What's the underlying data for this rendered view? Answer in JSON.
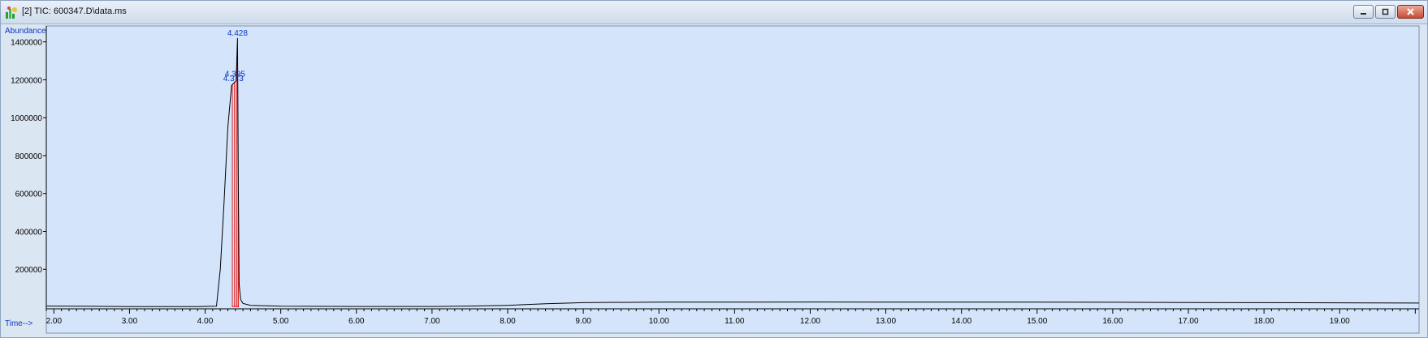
{
  "window": {
    "title": "[2] TIC: 600347.D\\data.ms",
    "icon": "chromatogram-app-icon",
    "controls": {
      "minimize": "minimize-icon",
      "restore": "restore-icon",
      "close": "close-icon"
    },
    "colors": {
      "plot_bg": "#d4e5fb",
      "frame": "#dbe6f3",
      "label": "#0b36c8",
      "trace": "#000000",
      "integration": "#e02020"
    }
  },
  "chart_data": {
    "type": "line",
    "xlabel": "Time-->",
    "ylabel": "Abundance",
    "xlim": [
      1.9,
      20.05
    ],
    "ylim": [
      0,
      1450000
    ],
    "x_ticks": [
      {
        "value": 2,
        "label": "2.00"
      },
      {
        "value": 3,
        "label": "3.00"
      },
      {
        "value": 4,
        "label": "4.00"
      },
      {
        "value": 5,
        "label": "5.00"
      },
      {
        "value": 6,
        "label": "6.00"
      },
      {
        "value": 7,
        "label": "7.00"
      },
      {
        "value": 8,
        "label": "8.00"
      },
      {
        "value": 9,
        "label": "9.00"
      },
      {
        "value": 10,
        "label": "10.00"
      },
      {
        "value": 11,
        "label": "11.00"
      },
      {
        "value": 12,
        "label": "12.00"
      },
      {
        "value": 13,
        "label": "13.00"
      },
      {
        "value": 14,
        "label": "14.00"
      },
      {
        "value": 15,
        "label": "15.00"
      },
      {
        "value": 16,
        "label": "16.00"
      },
      {
        "value": 17,
        "label": "17.00"
      },
      {
        "value": 18,
        "label": "18.00"
      },
      {
        "value": 19,
        "label": "19.00"
      }
    ],
    "y_ticks": [
      {
        "value": 200000,
        "label": "200000"
      },
      {
        "value": 400000,
        "label": "400000"
      },
      {
        "value": 600000,
        "label": "600000"
      },
      {
        "value": 800000,
        "label": "800000"
      },
      {
        "value": 1000000,
        "label": "1000000"
      },
      {
        "value": 1200000,
        "label": "1200000"
      },
      {
        "value": 1400000,
        "label": "1400000"
      }
    ],
    "series": [
      {
        "x": [
          1.9,
          2.5,
          3.0,
          3.5,
          3.9,
          4.15,
          4.2,
          4.25,
          4.3,
          4.35,
          4.373,
          4.395,
          4.41,
          4.428,
          4.44,
          4.45,
          4.47,
          4.5,
          4.6,
          5.0,
          6.0,
          7.0,
          7.5,
          8.0,
          8.5,
          9.0,
          10.0,
          11.0,
          12.0,
          13.0,
          14.0,
          15.0,
          16.0,
          17.0,
          18.0,
          19.0,
          20.05
        ],
        "y": [
          6000,
          4500,
          3500,
          3000,
          3500,
          5000,
          200000,
          550000,
          950000,
          1170000,
          1180000,
          1190000,
          1195000,
          1420000,
          600000,
          120000,
          40000,
          20000,
          10000,
          5000,
          4000,
          4000,
          6000,
          10000,
          18000,
          24000,
          27000,
          27000,
          27500,
          27000,
          27000,
          26500,
          26000,
          25000,
          24000,
          23000,
          22000
        ]
      }
    ],
    "integration_peaks": [
      {
        "rt": 4.373,
        "start": 4.36,
        "end": 4.39
      },
      {
        "rt": 4.395,
        "start": 4.39,
        "end": 4.42
      },
      {
        "rt": 4.428,
        "start": 4.42,
        "end": 4.44
      }
    ],
    "peak_labels": [
      {
        "x": 4.428,
        "y": 1420000,
        "text": "4.428"
      },
      {
        "x": 4.395,
        "y": 1205000,
        "text": "4.395"
      },
      {
        "x": 4.373,
        "y": 1180000,
        "text": "4.373"
      }
    ]
  }
}
